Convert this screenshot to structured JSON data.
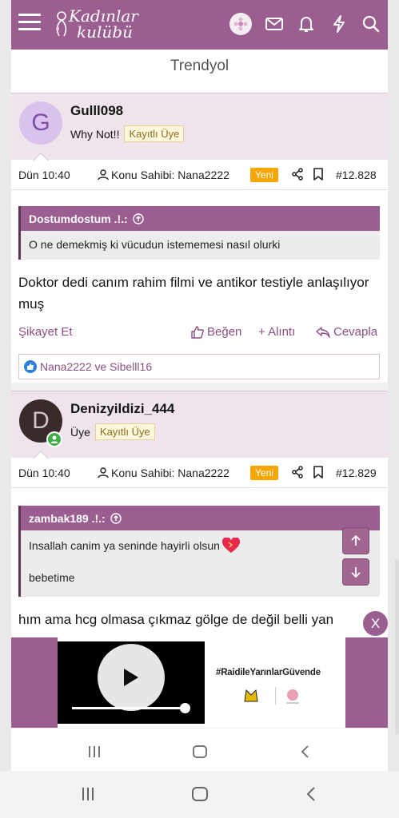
{
  "header": {
    "logo_line1": "Kadınlar",
    "logo_line2": "kulübü",
    "brand_color": "#9a5e91",
    "icons": [
      "menu-icon",
      "user-avatar",
      "mail-icon",
      "bell-icon",
      "lightning-icon",
      "search-icon"
    ]
  },
  "page_title": "Trendyol",
  "posts": [
    {
      "avatar_letter": "G",
      "avatar_color": "#d9c3ec",
      "avatar_text_color": "#7b4ea8",
      "username": "Gulll098",
      "user_title": "Why Not!!",
      "badge": "Kayıtlı Üye",
      "date": "Dün 10:40",
      "op_label": "Konu Sahibi: Nana2222",
      "new_label": "Yeni",
      "post_number": "#12.828",
      "quote_author": "Dostumdostum .!.:",
      "quote_lines": [
        "O ne demekmiş ki vücudun istememesi nasıl olurki"
      ],
      "text": "Doktor dedi canım rahim filmi ve antikor testiyle anlaşılıyor muş",
      "actions": {
        "report": "Şikayet Et",
        "like": "Beğen",
        "quote": "+ Alıntı",
        "reply": "Cevapla"
      },
      "reactions": "Nana2222 ve Sibelll16"
    },
    {
      "avatar_letter": "D",
      "avatar_color": "#3b2a2a",
      "avatar_text_color": "#cfc7c7",
      "username": "Denizyildizi_444",
      "user_title": "Üye",
      "badge": "Kayıtlı Üye",
      "date": "Dün 10:40",
      "op_label": "Konu Sahibi: Nana2222",
      "new_label": "Yeni",
      "post_number": "#12.829",
      "quote_author": "zambak189 .!.:",
      "quote_lines": [
        "Insallah canim ya seninde hayirli olsun",
        "bebetime"
      ],
      "text": "hım ama hcg olmasa çıkmaz gölge de değil belli yan"
    }
  ],
  "ad": {
    "hashtag": "#RaidileYarınlarGüvende",
    "close_label": "X"
  }
}
